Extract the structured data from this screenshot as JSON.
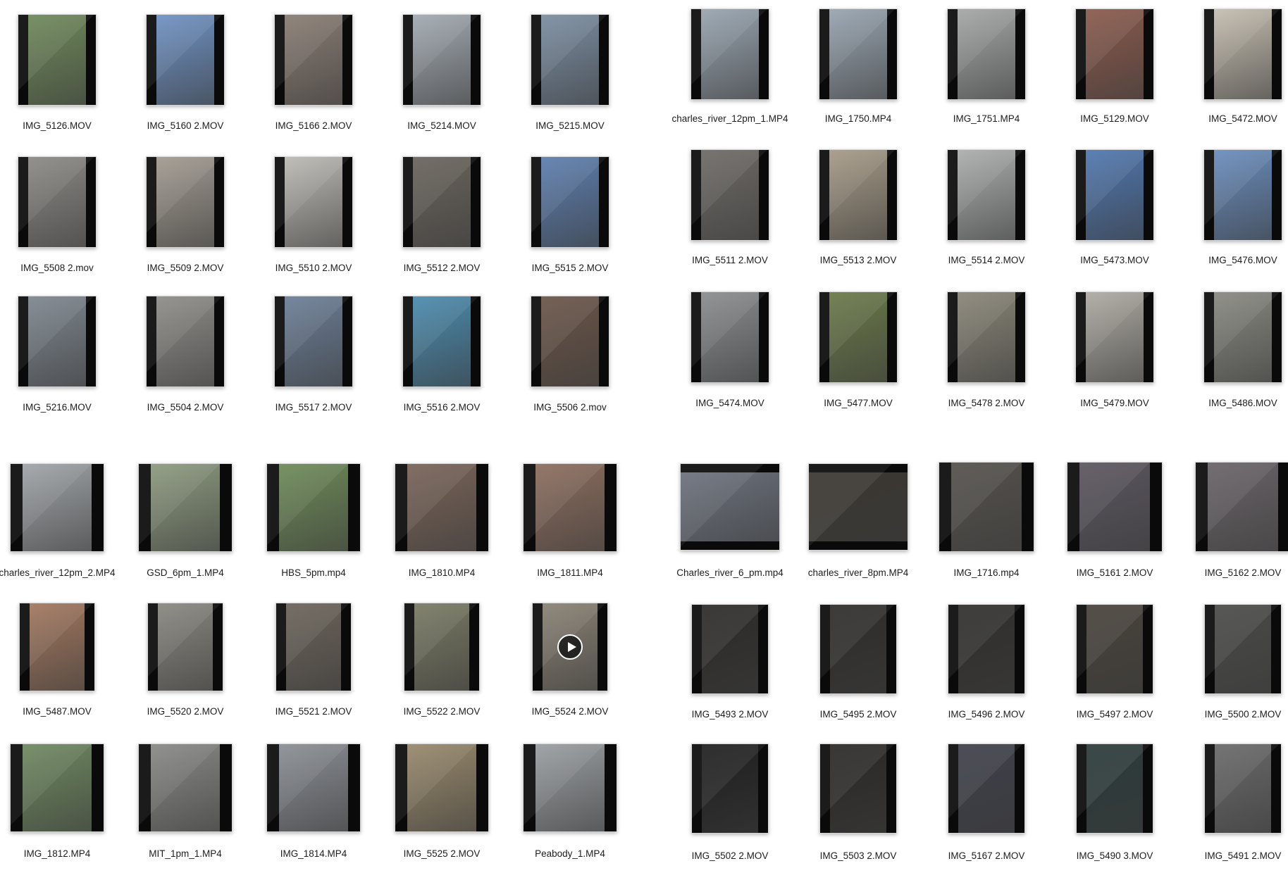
{
  "files": [
    {
      "name": "IMG_5126.MOV",
      "c": "#6f8a5a"
    },
    {
      "name": "IMG_5160 2.MOV",
      "c": "#6f93c6"
    },
    {
      "name": "IMG_5166 2.MOV",
      "c": "#8a7d74"
    },
    {
      "name": "IMG_5214.MOV",
      "c": "#a4acb4"
    },
    {
      "name": "IMG_5215.MOV",
      "c": "#7c8fa4"
    },
    {
      "name": "charles_river_12pm_1.MP4",
      "c": "#9aa6b2"
    },
    {
      "name": "IMG_1750.MP4",
      "c": "#9aa6b2"
    },
    {
      "name": "IMG_1751.MP4",
      "c": "#a7a9a8"
    },
    {
      "name": "IMG_5129.MOV",
      "c": "#8c5a4c"
    },
    {
      "name": "IMG_5472.MOV",
      "c": "#c8c0b2"
    },
    {
      "name": "IMG_5508 2.mov",
      "c": "#8d8a86"
    },
    {
      "name": "IMG_5509 2.MOV",
      "c": "#a39c92"
    },
    {
      "name": "IMG_5510 2.MOV",
      "c": "#bfbcb6"
    },
    {
      "name": "IMG_5512 2.MOV",
      "c": "#6a645c"
    },
    {
      "name": "IMG_5515 2.MOV",
      "c": "#5d7fb0"
    },
    {
      "name": "IMG_5511 2.MOV",
      "c": "#6e6a66"
    },
    {
      "name": "IMG_5513 2.MOV",
      "c": "#a89c88"
    },
    {
      "name": "IMG_5514 2.MOV",
      "c": "#aeb0b0"
    },
    {
      "name": "IMG_5473.MOV",
      "c": "#4f78b2"
    },
    {
      "name": "IMG_5476.MOV",
      "c": "#6a8ec0"
    },
    {
      "name": "IMG_5216.MOV",
      "c": "#7e8790"
    },
    {
      "name": "IMG_5504 2.MOV",
      "c": "#8f8e8a"
    },
    {
      "name": "IMG_5517 2.MOV",
      "c": "#6c7f98"
    },
    {
      "name": "IMG_5516 2.MOV",
      "c": "#4a8cb0"
    },
    {
      "name": "IMG_5506 2.mov",
      "c": "#6b5548"
    },
    {
      "name": "IMG_5474.MOV",
      "c": "#8b8e90"
    },
    {
      "name": "IMG_5477.MOV",
      "c": "#6a7a48"
    },
    {
      "name": "IMG_5478 2.MOV",
      "c": "#8a8678"
    },
    {
      "name": "IMG_5479.MOV",
      "c": "#b0aca4"
    },
    {
      "name": "IMG_5486.MOV",
      "c": "#8a8a82"
    },
    {
      "name": "charles_river_12pm_2.MP4",
      "c": "#a2a6aa"
    },
    {
      "name": "GSD_6pm_1.MP4",
      "c": "#8e9c80"
    },
    {
      "name": "HBS_5pm.mp4",
      "c": "#6e8c58"
    },
    {
      "name": "IMG_1810.MP4",
      "c": "#7a6458"
    },
    {
      "name": "IMG_1811.MP4",
      "c": "#8e6e5e"
    },
    {
      "name": "Charles_river_6_pm.mp4",
      "c": "#6e7480"
    },
    {
      "name": "charles_river_8pm.MP4",
      "c": "#3a3630"
    },
    {
      "name": "IMG_1716.mp4",
      "c": "#55514c"
    },
    {
      "name": "IMG_5161 2.MOV",
      "c": "#5c5660"
    },
    {
      "name": "IMG_5162 2.MOV",
      "c": "#6a6468"
    },
    {
      "name": "IMG_5487.MOV",
      "c": "#a4785e"
    },
    {
      "name": "IMG_5520 2.MOV",
      "c": "#8a8880"
    },
    {
      "name": "IMG_5521 2.MOV",
      "c": "#6c645a"
    },
    {
      "name": "IMG_5522 2.MOV",
      "c": "#7a7a64"
    },
    {
      "name": "IMG_5524 2.MOV",
      "c": "#8a8274"
    },
    {
      "name": "IMG_5493 2.MOV",
      "c": "#2c2a28"
    },
    {
      "name": "IMG_5495 2.MOV",
      "c": "#2e2c2a"
    },
    {
      "name": "IMG_5496 2.MOV",
      "c": "#302e2c"
    },
    {
      "name": "IMG_5497 2.MOV",
      "c": "#48423a"
    },
    {
      "name": "IMG_5500 2.MOV",
      "c": "#4a4a48"
    },
    {
      "name": "IMG_1812.MP4",
      "c": "#6f8a60"
    },
    {
      "name": "MIT_1pm_1.MP4",
      "c": "#8a8a88"
    },
    {
      "name": "IMG_1814.MP4",
      "c": "#8c9096"
    },
    {
      "name": "IMG_5525 2.MOV",
      "c": "#9a8a6c"
    },
    {
      "name": "Peabody_1.MP4",
      "c": "#9ca0a4"
    },
    {
      "name": "IMG_5502 2.MOV",
      "c": "#1e1e1e"
    },
    {
      "name": "IMG_5503 2.MOV",
      "c": "#2a2826"
    },
    {
      "name": "IMG_5167 2.MOV",
      "c": "#3e404a"
    },
    {
      "name": "IMG_5490 3.MOV",
      "c": "#2a3a3a"
    },
    {
      "name": "IMG_5491 2.MOV",
      "c": "#6a6a6a"
    }
  ]
}
